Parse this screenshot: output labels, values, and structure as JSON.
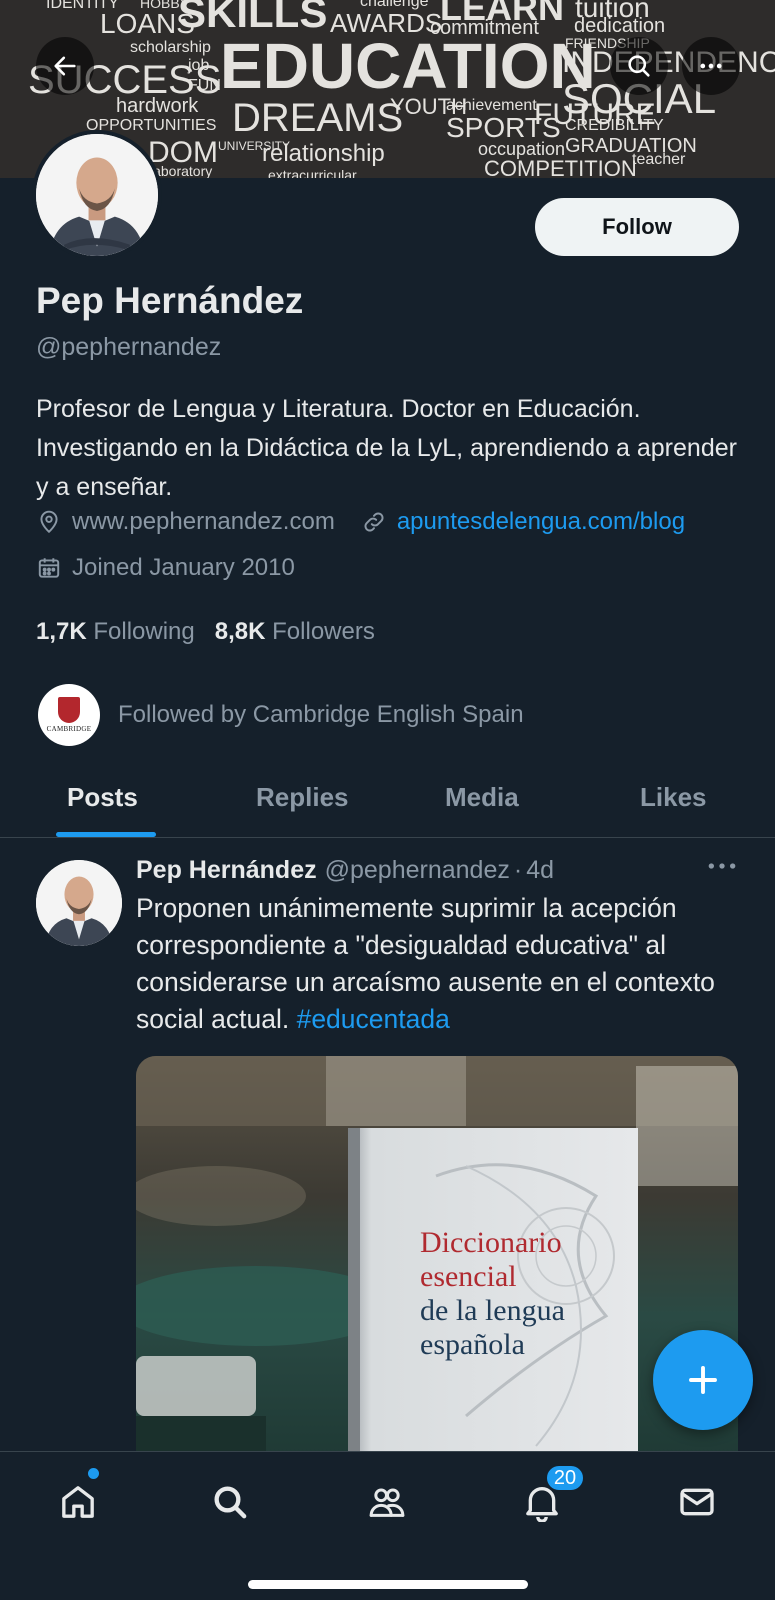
{
  "banner": {
    "words": [
      "IDENTITY",
      "HOBBY",
      "LOANS",
      "SKILLS",
      "AWARDS",
      "challenge",
      "LEARN",
      "tuition",
      "commitment",
      "dedication",
      "scholarship",
      "EDUCATION",
      "FRIENDSHIP",
      "SUCCESS",
      "job",
      "FUN",
      "INDEPENDENCE",
      "SOCIAL",
      "hardwork",
      "DREAMS",
      "YOUTH",
      "achievement",
      "OPPORTUNITIES",
      "SPORTS",
      "FUTURE",
      "CREDIBILITY",
      "DOM",
      "UNIVERSITY",
      "relationship",
      "occupation",
      "GRADUATION",
      "COMPETITION",
      "teacher",
      "extracurricular",
      "laboratory"
    ],
    "back_icon": "arrow-left-icon",
    "search_icon": "search-icon",
    "more_icon": "more-horizontal-icon"
  },
  "profile": {
    "follow_label": "Follow",
    "display_name": "Pep Hernández",
    "handle": "@pephernandez",
    "bio": "Profesor de Lengua y Literatura. Doctor en Educación. Investigando en la Didáctica de la LyL, aprendiendo a aprender y a enseñar.",
    "location_text": "www.pephernandez.com",
    "website": "apuntesdelengua.com/blog",
    "joined": "Joined January 2010",
    "following_count": "1,7K",
    "following_label": "Following",
    "followers_count": "8,8K",
    "followers_label": "Followers",
    "followed_by": "Followed by Cambridge English Spain",
    "followed_by_logo_text": "CAMBRIDGE"
  },
  "tabs": [
    {
      "label": "Posts",
      "active": true
    },
    {
      "label": "Replies",
      "active": false
    },
    {
      "label": "Media",
      "active": false
    },
    {
      "label": "Likes",
      "active": false
    }
  ],
  "post": {
    "author_name": "Pep Hernández",
    "author_handle": "@pephernandez",
    "separator": "·",
    "time": "4d",
    "text": "Proponen unánimemente suprimir la acepción correspondiente a \"desigualdad educativa\" al considerarse un arcaísmo ausente en el contexto social actual.",
    "hashtag": "#educentada",
    "image_book_title": [
      "Diccionario",
      "esencial",
      "de la lengua",
      "española"
    ]
  },
  "bottom_nav": {
    "items": [
      "home-icon",
      "search-icon",
      "communities-icon",
      "notifications-icon",
      "messages-icon"
    ],
    "notification_badge": "20"
  },
  "colors": {
    "background": "#15202b",
    "accent": "#1d9bf0",
    "text_primary": "#e7e9ea",
    "text_secondary": "#8b98a5"
  }
}
